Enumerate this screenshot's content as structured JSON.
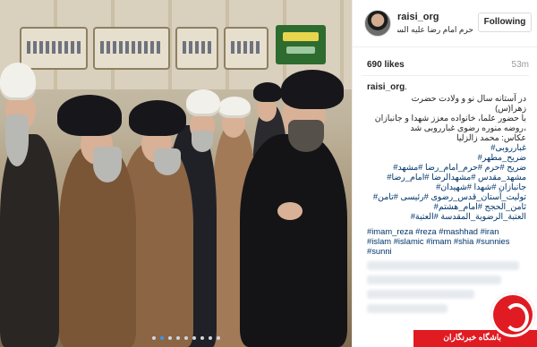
{
  "post": {
    "username": "raisi_org",
    "location": "حرم امام رضا علیه السلام",
    "follow_label": "Following",
    "likes": "690 likes",
    "time": "53m",
    "colors": {
      "link": "#003569",
      "text": "#262626",
      "muted": "#999999",
      "watermark": "#e01b22"
    }
  },
  "caption": {
    "username": "raisi_org",
    "dot": ".",
    "rtl_lines": [
      "در آستانه سال نو و ولادت حضرت",
      "زهرا(س)",
      "با حضور علما، خانواده معزز شهدا و جانبازان",
      "،روضه منوره رضوی غبارروبی شد",
      "عکاس: محمد زالزلیا",
      "غبارروبی#",
      "ضریح_مطهر#",
      "ضریح #حرم #حرم_امام_رضا #مشهد#",
      "مشهد_مقدس #مشهدالرضا #امام_رضا#",
      "جانبازان #شهدا #شهیدان#",
      "تولیت_آستان_قدس_رضوی #رئیسی #تامن#",
      "ثامن_الحجج #امام_هشتم#",
      "العتبة_الرضوية_المقدسة #العتبة#"
    ],
    "ltr_lines": [
      "#imam_reza #reza #mashhad #iran",
      "#islam #islamic #imam #shia #sunnies",
      "#sunni"
    ]
  },
  "carousel": {
    "count": 9,
    "active": 1
  },
  "watermark": {
    "text": "باشگاه خبرنگاران",
    "logo": "yjc-logo-icon"
  }
}
